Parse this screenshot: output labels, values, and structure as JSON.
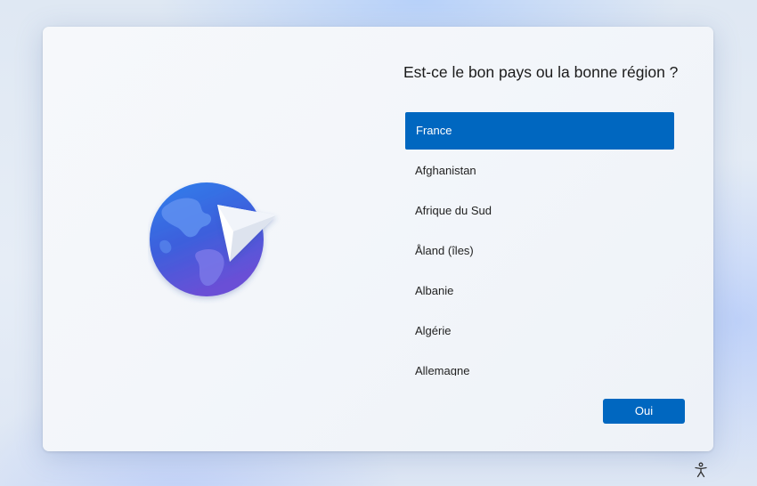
{
  "setup": {
    "title": "Est-ce le bon pays ou la bonne région ?",
    "countries": [
      "France",
      "Afghanistan",
      "Afrique du Sud",
      "Åland (îles)",
      "Albanie",
      "Algérie",
      "Allemagne"
    ],
    "selected": "France",
    "confirm_label": "Oui"
  },
  "icons": {
    "illustration": "globe-with-paper-plane-icon",
    "accessibility": "accessibility-icon"
  },
  "colors": {
    "accent": "#0067c0",
    "globe_top": "#2f74e0",
    "globe_bottom": "#6a4fd6"
  }
}
